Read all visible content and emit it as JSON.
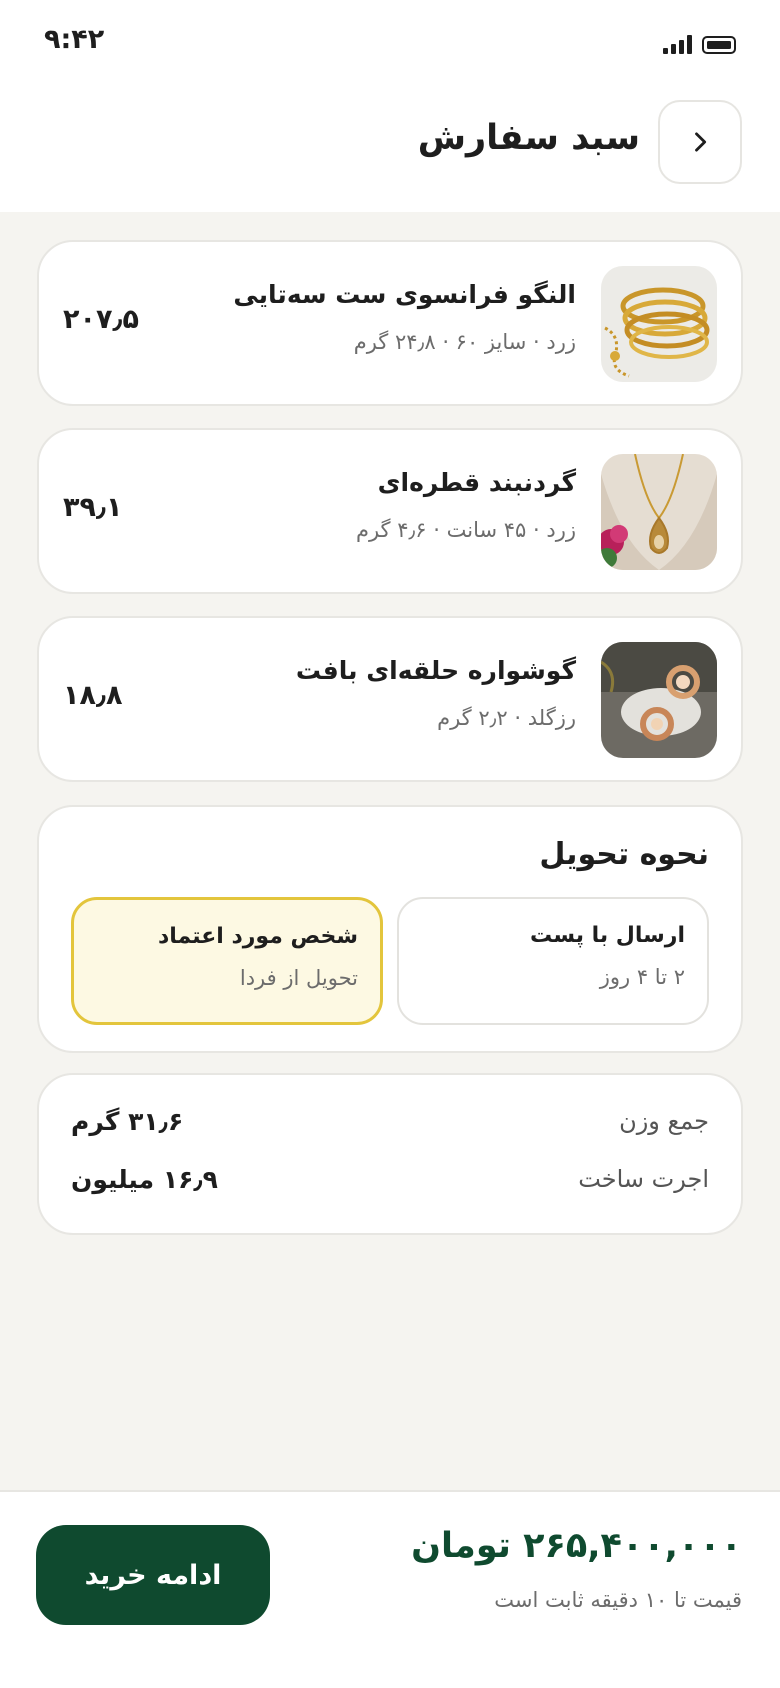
{
  "status_bar": {
    "time": "۹:۴۲",
    "icons": [
      "signal-icon",
      "battery-icon"
    ]
  },
  "header": {
    "title": "سبد سفارش",
    "back_icon": "chevron-right-icon"
  },
  "items": [
    {
      "name": "النگو فرانسوی ست سه‌تایی",
      "meta": "زرد · سایز ۶۰ · ۲۴٫۸ گرم",
      "price": "۲۰۷٫۵",
      "image": "gold-bangles"
    },
    {
      "name": "گردنبند قطره‌ای",
      "meta": "زرد · ۴۵ سانت · ۴٫۶ گرم",
      "price": "۳۹٫۱",
      "image": "drop-necklace"
    },
    {
      "name": "گوشواره حلقه‌ای بافت",
      "meta": "رزگلد · ۲٫۲ گرم",
      "price": "۱۸٫۸",
      "image": "hoop-earrings"
    }
  ],
  "delivery": {
    "title": "نحوه تحویل",
    "options": [
      {
        "title": "ارسال با پست",
        "subtitle": "۲ تا ۴ روز",
        "selected": false
      },
      {
        "title": "شخص مورد اعتماد",
        "subtitle": "تحویل از فردا",
        "selected": true
      }
    ]
  },
  "summary": {
    "rows": [
      {
        "label": "جمع وزن",
        "value": "۳۱٫۶ گرم"
      },
      {
        "label": "اجرت ساخت",
        "value": "۱۶٫۹ میلیون"
      }
    ]
  },
  "footer": {
    "total": "۲۶۵,۴۰۰,۰۰۰ تومان",
    "note": "قیمت تا ۱۰ دقیقه ثابت است",
    "button": "ادامه خرید"
  },
  "colors": {
    "primary": "#0f4a2f",
    "selected_border": "#e3c53c",
    "selected_bg": "#fdf9e3",
    "background": "#f5f4f0"
  }
}
